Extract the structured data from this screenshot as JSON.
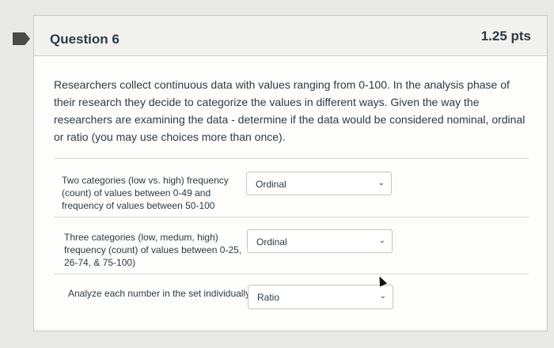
{
  "question": {
    "title": "Question 6",
    "points": "1.25 pts",
    "text": "Researchers collect continuous data with values ranging from 0-100. In the analysis phase of their research they decide to categorize the values in different ways. Given the way the researchers are examining the data - determine if the data would be considered nominal, ordinal or ratio (you may use choices more than once)."
  },
  "rows": [
    {
      "label": "Two categories (low vs. high) frequency (count) of values between 0-49 and frequency of values between 50-100",
      "selected": "Ordinal"
    },
    {
      "label": "Three categories (low, medum, high) frequency (count) of values between 0-25, 26-74, & 75-100)",
      "selected": "Ordinal"
    },
    {
      "label": "Analyze each number in the set individually",
      "selected": "Ratio"
    }
  ],
  "icons": {
    "flag": "flag-icon",
    "dropdown": "chevron-down-icon",
    "cursor": "mouse-cursor-icon"
  },
  "colors": {
    "flag": "#4a4a48",
    "text": "#2d3b45",
    "header_bg": "#f1f1ee"
  }
}
